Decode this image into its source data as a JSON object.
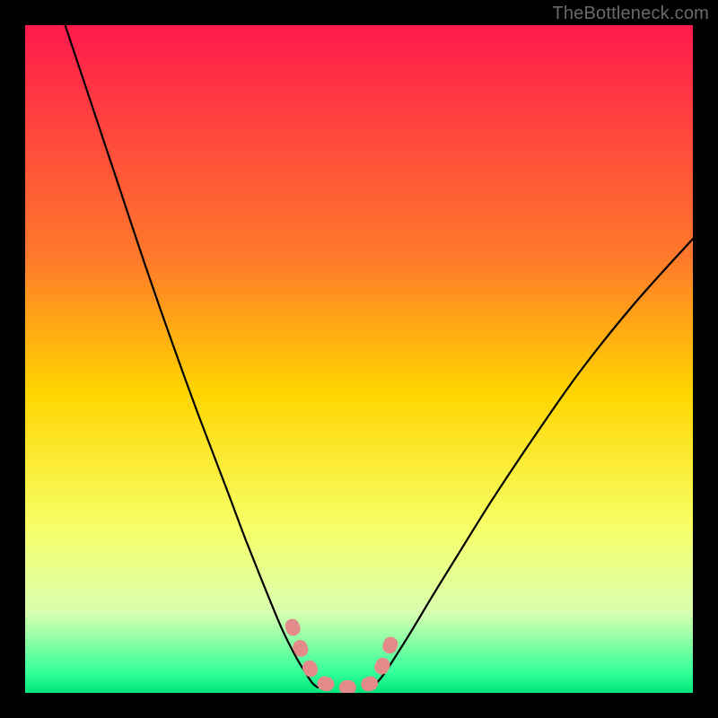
{
  "watermark": {
    "text": "TheBottleneck.com"
  },
  "chart_data": {
    "type": "line",
    "title": "",
    "xlabel": "",
    "ylabel": "",
    "xlim": [
      0,
      100
    ],
    "ylim": [
      0,
      100
    ],
    "grid": false,
    "legend": "none",
    "background_gradient": {
      "stops": [
        {
          "pos": 0.0,
          "color": "#ff1a4d"
        },
        {
          "pos": 0.35,
          "color": "#ff7a2a"
        },
        {
          "pos": 0.55,
          "color": "#ffd500"
        },
        {
          "pos": 0.75,
          "color": "#f7ff66"
        },
        {
          "pos": 0.88,
          "color": "#d8ffb0"
        },
        {
          "pos": 0.97,
          "color": "#33ff99"
        },
        {
          "pos": 1.0,
          "color": "#00e67a"
        }
      ]
    },
    "series": [
      {
        "name": "left-curve",
        "color": "#000000",
        "x": [
          6,
          10,
          14,
          18,
          22,
          26,
          30,
          33,
          36,
          38.5,
          40.5,
          42,
          43,
          43.8
        ],
        "y": [
          100,
          88,
          76,
          64,
          52.5,
          41.5,
          31,
          23,
          15.5,
          9.5,
          5.5,
          3,
          1.5,
          0.8
        ]
      },
      {
        "name": "right-curve",
        "color": "#000000",
        "x": [
          52,
          53.5,
          55.5,
          58,
          61,
          65,
          70,
          76,
          83,
          91,
          100
        ],
        "y": [
          0.8,
          2.5,
          5.5,
          9.5,
          14.5,
          21,
          29,
          38,
          48,
          58,
          68
        ]
      },
      {
        "name": "pink-floor",
        "color": "#e38b8b",
        "x": [
          40,
          41.5,
          43,
          44.5,
          47,
          50,
          52,
          53.5,
          55
        ],
        "y": [
          10,
          6,
          3,
          1.5,
          0.8,
          0.8,
          1.5,
          4,
          8
        ]
      }
    ],
    "annotations": []
  }
}
